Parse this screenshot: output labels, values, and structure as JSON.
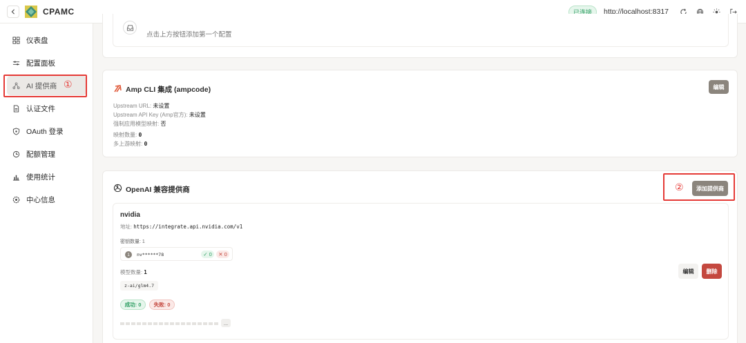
{
  "app": {
    "title": "CPAMC",
    "connection_status": "已连接",
    "server_url": "http://localhost:8317"
  },
  "sidebar": {
    "items": [
      {
        "label": "仪表盘",
        "icon": "dashboard-icon"
      },
      {
        "label": "配置面板",
        "icon": "sliders-icon"
      },
      {
        "label": "AI 提供商",
        "icon": "nodes-icon",
        "active": true
      },
      {
        "label": "认证文件",
        "icon": "file-icon"
      },
      {
        "label": "OAuth 登录",
        "icon": "shield-icon"
      },
      {
        "label": "配额管理",
        "icon": "clock-icon"
      },
      {
        "label": "使用统计",
        "icon": "bar-chart-icon"
      },
      {
        "label": "中心信息",
        "icon": "info-gear-icon"
      }
    ],
    "annotation_1": "①"
  },
  "empty_config": {
    "hint": "点击上方按钮添加第一个配置"
  },
  "amp": {
    "title": "Amp CLI 集成 (ampcode)",
    "edit_label": "编辑",
    "fields": [
      {
        "key": "Upstream URL:",
        "value": "未设置"
      },
      {
        "key": "Upstream API Key (Amp官方):",
        "value": "未设置"
      },
      {
        "key": "强制应用模型映射:",
        "value": "否"
      },
      {
        "key": "映射数量:",
        "value": "0"
      },
      {
        "key": "多上游映射:",
        "value": "0"
      }
    ]
  },
  "openai": {
    "title": "OpenAI 兼容提供商",
    "annotation_2": "②",
    "add_label": "添加提供商",
    "provider": {
      "name": "nvidia",
      "address_label": "地址:",
      "address": "https://integrate.api.nvidia.com/v1",
      "key_count_label": "密钥数量: 1",
      "key_index": "1",
      "key_masked": "nv******78",
      "key_success": "0",
      "key_fail": "0",
      "model_count_label": "模型数量:",
      "model_count": "1",
      "model_name": "z-ai/glm4.7",
      "success_label": "成功: 0",
      "fail_label": "失败: 0",
      "more_label": "...",
      "edit_label": "编辑",
      "delete_label": "删除"
    }
  },
  "colors": {
    "accent": "#8b857d",
    "danger": "#c4483f",
    "success": "#2f9e63",
    "annotation": "#e53935"
  }
}
